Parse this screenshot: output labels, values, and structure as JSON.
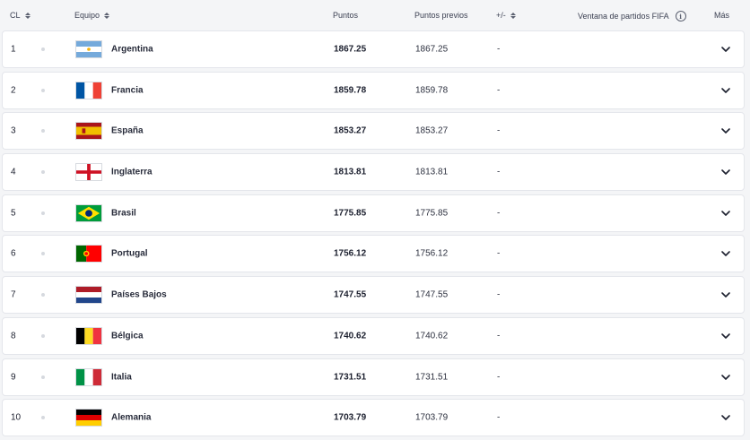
{
  "header": {
    "rank": "CL",
    "team": "Equipo",
    "points": "Puntos",
    "prev": "Puntos previos",
    "diff": "+/-",
    "window": "Ventana de partidos FIFA",
    "more": "Más"
  },
  "rows": [
    {
      "rank": "1",
      "team": "Argentina",
      "flag": "argentina",
      "points": "1867.25",
      "prev": "1867.25",
      "diff": "-"
    },
    {
      "rank": "2",
      "team": "Francia",
      "flag": "france",
      "points": "1859.78",
      "prev": "1859.78",
      "diff": "-"
    },
    {
      "rank": "3",
      "team": "España",
      "flag": "spain",
      "points": "1853.27",
      "prev": "1853.27",
      "diff": "-"
    },
    {
      "rank": "4",
      "team": "Inglaterra",
      "flag": "england",
      "points": "1813.81",
      "prev": "1813.81",
      "diff": "-"
    },
    {
      "rank": "5",
      "team": "Brasil",
      "flag": "brazil",
      "points": "1775.85",
      "prev": "1775.85",
      "diff": "-"
    },
    {
      "rank": "6",
      "team": "Portugal",
      "flag": "portugal",
      "points": "1756.12",
      "prev": "1756.12",
      "diff": "-"
    },
    {
      "rank": "7",
      "team": "Países Bajos",
      "flag": "netherlands",
      "points": "1747.55",
      "prev": "1747.55",
      "diff": "-"
    },
    {
      "rank": "8",
      "team": "Bélgica",
      "flag": "belgium",
      "points": "1740.62",
      "prev": "1740.62",
      "diff": "-"
    },
    {
      "rank": "9",
      "team": "Italia",
      "flag": "italy",
      "points": "1731.51",
      "prev": "1731.51",
      "diff": "-"
    },
    {
      "rank": "10",
      "team": "Alemania",
      "flag": "germany",
      "points": "1703.79",
      "prev": "1703.79",
      "diff": "-"
    }
  ],
  "colors": {
    "row_bg": "#ffffff",
    "page_bg": "#f4f5f7",
    "text": "#1b1f2e"
  }
}
